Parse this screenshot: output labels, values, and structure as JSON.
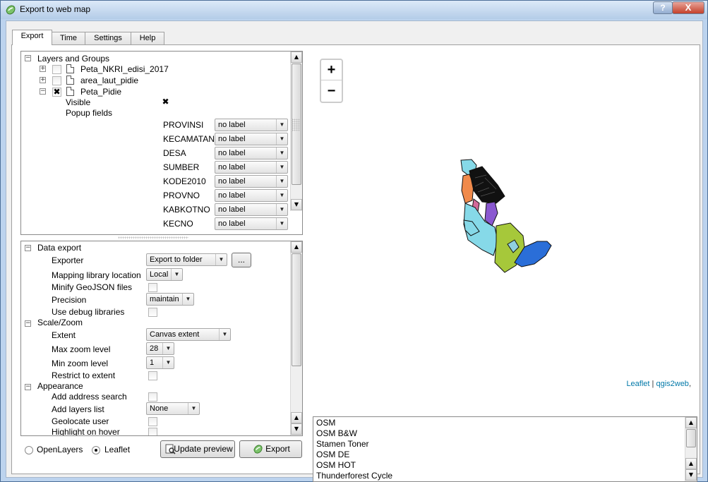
{
  "window": {
    "title": "Export to web map",
    "help_label": "?",
    "close_label": "X"
  },
  "tabs": [
    "Export",
    "Time",
    "Settings",
    "Help"
  ],
  "layers": {
    "header": "Layers and Groups",
    "items": [
      {
        "name": "Peta_NKRI_edisi_2017",
        "checked": ""
      },
      {
        "name": "area_laut_pidie",
        "checked": ""
      },
      {
        "name": "Peta_Pidie",
        "checked": "✖"
      }
    ],
    "visible_label": "Visible",
    "visible_mark": "✖",
    "popup_label": "Popup fields",
    "fields": [
      {
        "name": "PROVINSI",
        "value": "no label"
      },
      {
        "name": "KECAMATAN",
        "value": "no label"
      },
      {
        "name": "DESA",
        "value": "no label"
      },
      {
        "name": "SUMBER",
        "value": "no label"
      },
      {
        "name": "KODE2010",
        "value": "no label"
      },
      {
        "name": "PROVNO",
        "value": "no label"
      },
      {
        "name": "KABKOTNO",
        "value": "no label"
      },
      {
        "name": "KECNO",
        "value": "no label"
      }
    ]
  },
  "settings": {
    "data_export": {
      "header": "Data export",
      "exporter_label": "Exporter",
      "exporter_value": "Export to folder",
      "browse_label": "...",
      "mapping_label": "Mapping library location",
      "mapping_value": "Local",
      "minify_label": "Minify GeoJSON files",
      "precision_label": "Precision",
      "precision_value": "maintain",
      "debug_label": "Use debug libraries"
    },
    "scale_zoom": {
      "header": "Scale/Zoom",
      "extent_label": "Extent",
      "extent_value": "Canvas extent",
      "max_label": "Max zoom level",
      "max_value": "28",
      "min_label": "Min zoom level",
      "min_value": "1",
      "restrict_label": "Restrict to extent"
    },
    "appearance": {
      "header": "Appearance",
      "address_label": "Add address search",
      "layers_label": "Add layers list",
      "layers_value": "None",
      "geolocate_label": "Geolocate user",
      "highlight_label": "Highlight on hover"
    }
  },
  "bottom": {
    "openlayers_label": "OpenLayers",
    "leaflet_label": "Leaflet",
    "update_label": "Update preview",
    "export_label": "Export"
  },
  "map": {
    "zoom_in": "+",
    "zoom_out": "−",
    "attribution_leaflet": "Leaflet",
    "attribution_sep": " | ",
    "attribution_q2w": "qgis2web",
    "attribution_trail": ","
  },
  "basemaps": [
    "OSM",
    "OSM B&W",
    "Stamen Toner",
    "OSM DE",
    "OSM HOT",
    "Thunderforest Cycle"
  ],
  "colors": {
    "accent": "#0078a8",
    "map_cyan": "#86d9e8",
    "map_orange": "#f08a4b",
    "map_green": "#a6c83a",
    "map_blue": "#2a6ed8",
    "map_purple": "#8a58d0"
  }
}
